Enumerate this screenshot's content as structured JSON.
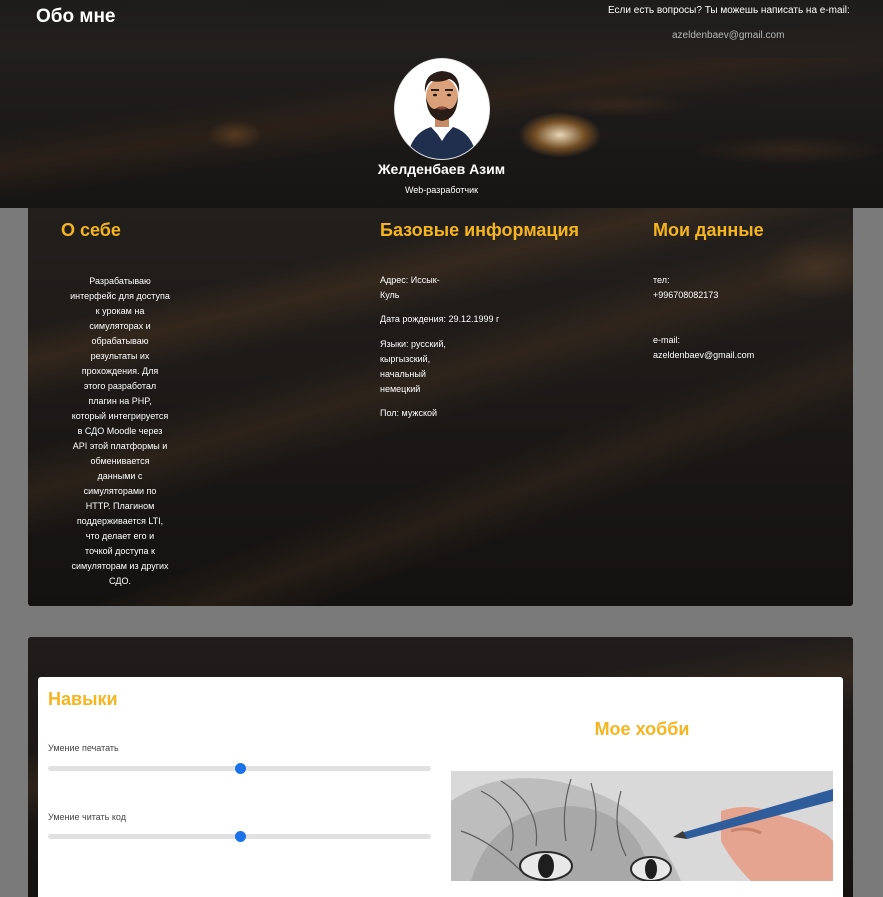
{
  "header": {
    "title": "Обо мне",
    "contact_question": "Если есть вопросы? Ты можешь написать на e-mail:",
    "contact_email": "azeldenbaev@gmail.com"
  },
  "profile": {
    "name": "Желденбаев Азим",
    "role": "Web-разработчик",
    "avatar_icon": "man-avatar"
  },
  "about": {
    "title": "О себе",
    "lines": [
      "Разрабатываю",
      "интерфейс для доступа",
      "к урокам на",
      "симуляторах и",
      "обрабатываю",
      "результаты их",
      "прохождения. Для",
      "этого разработал",
      "плагин на PHP,",
      "который интегрируется",
      "в СДО Moodle через",
      "API этой платформы и",
      "обменивается",
      "данными с",
      "симуляторами по",
      "HTTP. Плагином",
      "поддерживается LTI,",
      "что делает его и",
      "точкой доступа к",
      "симуляторам из других",
      "СДО."
    ]
  },
  "basic_info": {
    "title": "Базовые информация",
    "address_lines": [
      "Адрес: Иссык-",
      "Куль"
    ],
    "birth": "Дата рождения: 29.12.1999 г",
    "languages_lines": [
      "Языки: русский,",
      "кыргызский,",
      "начальный",
      "немецкий"
    ],
    "gender": "Пол: мужской"
  },
  "my_data": {
    "title": "Мои данные",
    "phone_label": "тел:",
    "phone": "+996708082173",
    "email_label": "e-mail:",
    "email": "azeldenbaev@gmail.com"
  },
  "skills": {
    "title": "Навыки",
    "items": [
      {
        "label": "Умение печатать",
        "level": 0.5
      },
      {
        "label": "Умение читать код",
        "level": 0.5
      }
    ]
  },
  "hobby": {
    "title": "Мое хобби",
    "image_icon": "cat-drawing-image"
  },
  "colors": {
    "accent": "#f5b520",
    "slider": "#1a73e8",
    "dark_bg": "#1d1b1a"
  }
}
